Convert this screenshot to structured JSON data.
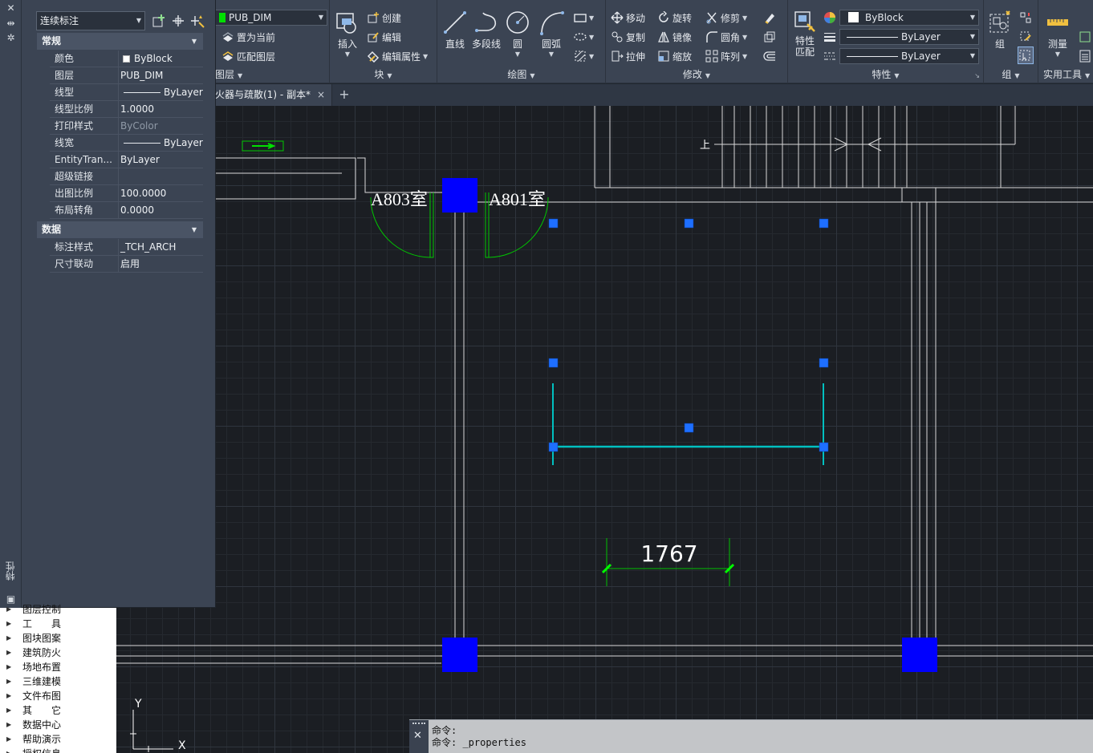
{
  "ribbon": {
    "layer_panel": {
      "layer_value": "PUB_DIM",
      "set_current": "置为当前",
      "match_layer": "匹配图层",
      "title": "图层"
    },
    "block_panel": {
      "insert": "插入",
      "create": "创建",
      "edit": "编辑",
      "edit_attributes": "编辑属性",
      "title": "块"
    },
    "draw_panel": {
      "line": "直线",
      "polyline": "多段线",
      "circle": "圆",
      "arc": "圆弧",
      "title": "绘图"
    },
    "modify_panel": {
      "move": "移动",
      "rotate": "旋转",
      "trim": "修剪",
      "copy": "复制",
      "mirror": "镜像",
      "fillet": "圆角",
      "stretch": "拉伸",
      "scale": "缩放",
      "array": "阵列",
      "title": "修改"
    },
    "properties_panel": {
      "match_properties": "特性\n匹配",
      "color": "ByBlock",
      "linetype": "ByLayer",
      "lineweight": "ByLayer",
      "title": "特性"
    },
    "group_panel": {
      "group": "组",
      "title": "组"
    },
    "utilities_panel": {
      "measure": "测量",
      "title": "实用工具"
    }
  },
  "tabs": {
    "doc_tab_label": "火器与疏散(1) - 副本*",
    "close_icon": "×",
    "new_tab_icon": "+"
  },
  "properties": {
    "strip_title": "特性",
    "object_type": "连续标注",
    "sections": {
      "general": "常规",
      "data": "数据"
    },
    "rows": [
      {
        "key": "颜色",
        "value": "ByBlock"
      },
      {
        "key": "图层",
        "value": "PUB_DIM"
      },
      {
        "key": "线型",
        "value": "ByLayer"
      },
      {
        "key": "线型比例",
        "value": "1.0000"
      },
      {
        "key": "打印样式",
        "value": "ByColor"
      },
      {
        "key": "线宽",
        "value": "ByLayer"
      },
      {
        "key": "EntityTran...",
        "value": "ByLayer"
      },
      {
        "key": "超级链接",
        "value": ""
      },
      {
        "key": "出图比例",
        "value": "100.0000"
      },
      {
        "key": "布局转角",
        "value": "0.0000"
      }
    ],
    "data_rows": [
      {
        "key": "标注样式",
        "value": "_TCH_ARCH"
      },
      {
        "key": "尺寸联动",
        "value": "启用"
      }
    ]
  },
  "tool_tree": {
    "items": [
      "图层控制",
      "工　　具",
      "图块图案",
      "建筑防火",
      "场地布置",
      "三维建模",
      "文件布图",
      "其　　它",
      "数据中心",
      "帮助演示",
      "授权信息"
    ]
  },
  "drawing": {
    "room_left": "A803室",
    "room_right": "A801室",
    "up_label": "上",
    "dimension_value": "1767",
    "ucs_y": "Y",
    "ucs_x": "X"
  },
  "command": {
    "line1": "命令:",
    "line2": "命令: _properties"
  },
  "colors": {
    "selection_grip": "#1e6fff",
    "column_fill": "#0000ff",
    "dimension_green": "#00ff00",
    "selected_dim": "#00c0c0",
    "door_green": "#00c800"
  }
}
